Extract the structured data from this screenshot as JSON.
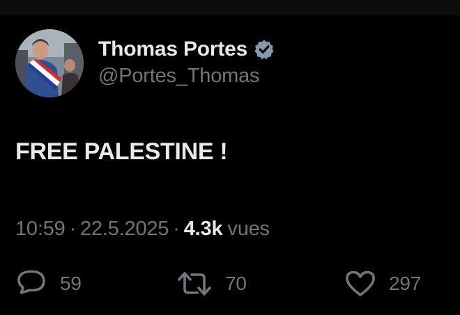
{
  "author": {
    "display_name": "Thomas Portes",
    "handle": "@Portes_Thomas",
    "verified_icon": "verified-badge-icon"
  },
  "tweet": {
    "text": "FREE PALESTINE !"
  },
  "meta": {
    "time": "10:59",
    "separator": "·",
    "date": "22.5.2025",
    "views_count": "4.3k",
    "views_label": "vues"
  },
  "actions": {
    "replies": "59",
    "retweets": "70",
    "likes": "297"
  },
  "colors": {
    "background": "#000000",
    "primary_text": "#e7e9ea",
    "secondary_text": "#71767b",
    "verified_badge": "#829aab"
  }
}
